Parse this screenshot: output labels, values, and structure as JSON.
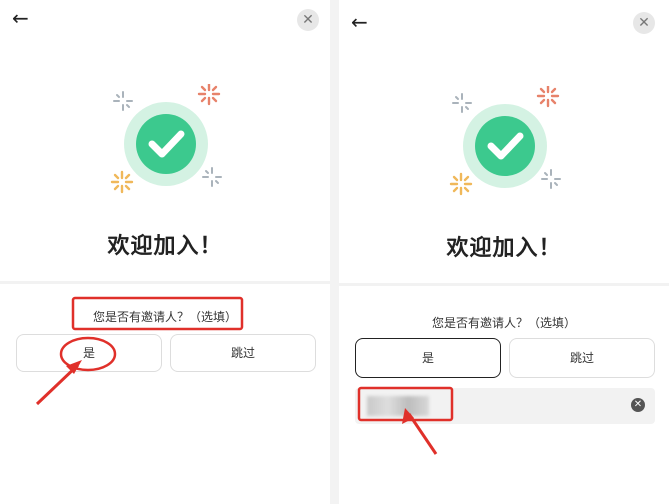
{
  "colors": {
    "accent_green": "#3cc98e",
    "ring_green": "#d4f2e3",
    "annotation_red": "#e0302a"
  },
  "screens": [
    {
      "back_icon": "←",
      "close_icon": "✕",
      "welcome": "欢迎加入！",
      "question": "您是否有邀请人？（选填）",
      "yes_label": "是",
      "skip_label": "跳过"
    },
    {
      "back_icon": "←",
      "close_icon": "✕",
      "welcome": "欢迎加入！",
      "question": "您是否有邀请人？（选填）",
      "yes_label": "是",
      "skip_label": "跳过",
      "invite_value_blurred": true,
      "clear_icon": "✕"
    }
  ]
}
